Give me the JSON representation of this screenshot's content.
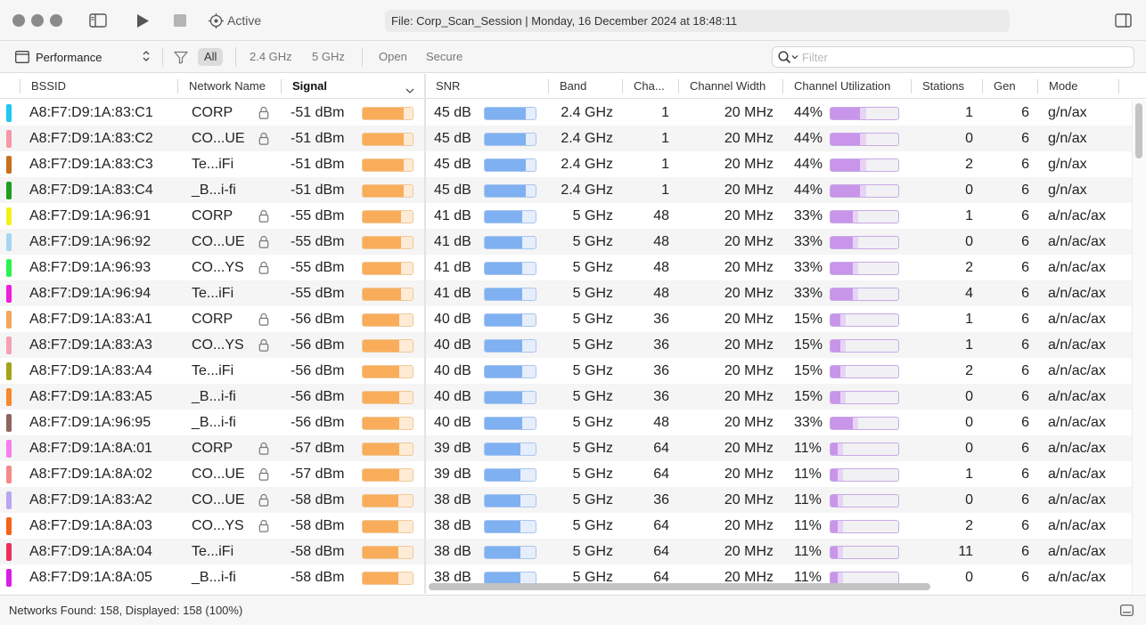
{
  "titlebar": {
    "state": "Active",
    "title": "File: Corp_Scan_Session | Monday, 16 December 2024 at 18:48:11"
  },
  "toolbar": {
    "view": "Performance",
    "filters": [
      "All",
      "2.4 GHz",
      "5 GHz",
      "Open",
      "Secure"
    ],
    "selected_filter": "All",
    "search_placeholder": "Filter"
  },
  "columns": {
    "bssid": "BSSID",
    "network_name": "Network Name",
    "signal": "Signal",
    "snr": "SNR",
    "band": "Band",
    "channel": "Cha...",
    "channel_width": "Channel Width",
    "channel_utilization": "Channel Utilization",
    "stations": "Stations",
    "gen": "Gen",
    "mode": "Mode"
  },
  "colors": {
    "signal_fill": "#f9ad5b",
    "snr_fill": "#7fb0f1",
    "util_fill": "#c895ea",
    "util_secondary": "#e6d3f6"
  },
  "rows": [
    {
      "color": "#1ec8ef",
      "bssid": "A8:F7:D9:1A:83:C1",
      "name": "CORP",
      "lock": true,
      "signal": "-51 dBm",
      "signal_level": 0.82,
      "snr": "45 dB",
      "snr_level": 0.8,
      "band": "2.4 GHz",
      "channel": "1",
      "width": "20 MHz",
      "util": "44%",
      "util_level": 0.44,
      "stations": "1",
      "gen": "6",
      "mode": "g/n/ax"
    },
    {
      "color": "#f598a8",
      "bssid": "A8:F7:D9:1A:83:C2",
      "name": "CO...UE",
      "lock": true,
      "signal": "-51 dBm",
      "signal_level": 0.82,
      "snr": "45 dB",
      "snr_level": 0.8,
      "band": "2.4 GHz",
      "channel": "1",
      "width": "20 MHz",
      "util": "44%",
      "util_level": 0.44,
      "stations": "0",
      "gen": "6",
      "mode": "g/n/ax"
    },
    {
      "color": "#c8711c",
      "bssid": "A8:F7:D9:1A:83:C3",
      "name": "Te...iFi",
      "lock": false,
      "signal": "-51 dBm",
      "signal_level": 0.82,
      "snr": "45 dB",
      "snr_level": 0.8,
      "band": "2.4 GHz",
      "channel": "1",
      "width": "20 MHz",
      "util": "44%",
      "util_level": 0.44,
      "stations": "2",
      "gen": "6",
      "mode": "g/n/ax"
    },
    {
      "color": "#1f9e1f",
      "bssid": "A8:F7:D9:1A:83:C4",
      "name": "_B...i-fi",
      "lock": false,
      "signal": "-51 dBm",
      "signal_level": 0.82,
      "snr": "45 dB",
      "snr_level": 0.8,
      "band": "2.4 GHz",
      "channel": "1",
      "width": "20 MHz",
      "util": "44%",
      "util_level": 0.44,
      "stations": "0",
      "gen": "6",
      "mode": "g/n/ax"
    },
    {
      "color": "#f4f01c",
      "bssid": "A8:F7:D9:1A:96:91",
      "name": "CORP",
      "lock": true,
      "signal": "-55 dBm",
      "signal_level": 0.76,
      "snr": "41 dB",
      "snr_level": 0.74,
      "band": "5 GHz",
      "channel": "48",
      "width": "20 MHz",
      "util": "33%",
      "util_level": 0.33,
      "stations": "1",
      "gen": "6",
      "mode": "a/n/ac/ax"
    },
    {
      "color": "#a8d6f0",
      "bssid": "A8:F7:D9:1A:96:92",
      "name": "CO...UE",
      "lock": true,
      "signal": "-55 dBm",
      "signal_level": 0.76,
      "snr": "41 dB",
      "snr_level": 0.74,
      "band": "5 GHz",
      "channel": "48",
      "width": "20 MHz",
      "util": "33%",
      "util_level": 0.33,
      "stations": "0",
      "gen": "6",
      "mode": "a/n/ac/ax"
    },
    {
      "color": "#2ef24e",
      "bssid": "A8:F7:D9:1A:96:93",
      "name": "CO...YS",
      "lock": true,
      "signal": "-55 dBm",
      "signal_level": 0.76,
      "snr": "41 dB",
      "snr_level": 0.74,
      "band": "5 GHz",
      "channel": "48",
      "width": "20 MHz",
      "util": "33%",
      "util_level": 0.33,
      "stations": "2",
      "gen": "6",
      "mode": "a/n/ac/ax"
    },
    {
      "color": "#ee1fd8",
      "bssid": "A8:F7:D9:1A:96:94",
      "name": "Te...iFi",
      "lock": false,
      "signal": "-55 dBm",
      "signal_level": 0.76,
      "snr": "41 dB",
      "snr_level": 0.74,
      "band": "5 GHz",
      "channel": "48",
      "width": "20 MHz",
      "util": "33%",
      "util_level": 0.33,
      "stations": "4",
      "gen": "6",
      "mode": "a/n/ac/ax"
    },
    {
      "color": "#f5a55c",
      "bssid": "A8:F7:D9:1A:83:A1",
      "name": "CORP",
      "lock": true,
      "signal": "-56 dBm",
      "signal_level": 0.74,
      "snr": "40 dB",
      "snr_level": 0.73,
      "band": "5 GHz",
      "channel": "36",
      "width": "20 MHz",
      "util": "15%",
      "util_level": 0.15,
      "stations": "1",
      "gen": "6",
      "mode": "a/n/ac/ax"
    },
    {
      "color": "#f6a1b1",
      "bssid": "A8:F7:D9:1A:83:A3",
      "name": "CO...YS",
      "lock": true,
      "signal": "-56 dBm",
      "signal_level": 0.74,
      "snr": "40 dB",
      "snr_level": 0.73,
      "band": "5 GHz",
      "channel": "36",
      "width": "20 MHz",
      "util": "15%",
      "util_level": 0.15,
      "stations": "1",
      "gen": "6",
      "mode": "a/n/ac/ax"
    },
    {
      "color": "#a3a31a",
      "bssid": "A8:F7:D9:1A:83:A4",
      "name": "Te...iFi",
      "lock": false,
      "signal": "-56 dBm",
      "signal_level": 0.74,
      "snr": "40 dB",
      "snr_level": 0.73,
      "band": "5 GHz",
      "channel": "36",
      "width": "20 MHz",
      "util": "15%",
      "util_level": 0.15,
      "stations": "2",
      "gen": "6",
      "mode": "a/n/ac/ax"
    },
    {
      "color": "#f58a2c",
      "bssid": "A8:F7:D9:1A:83:A5",
      "name": "_B...i-fi",
      "lock": false,
      "signal": "-56 dBm",
      "signal_level": 0.74,
      "snr": "40 dB",
      "snr_level": 0.73,
      "band": "5 GHz",
      "channel": "36",
      "width": "20 MHz",
      "util": "15%",
      "util_level": 0.15,
      "stations": "0",
      "gen": "6",
      "mode": "a/n/ac/ax"
    },
    {
      "color": "#8e6560",
      "bssid": "A8:F7:D9:1A:96:95",
      "name": "_B...i-fi",
      "lock": false,
      "signal": "-56 dBm",
      "signal_level": 0.74,
      "snr": "40 dB",
      "snr_level": 0.73,
      "band": "5 GHz",
      "channel": "48",
      "width": "20 MHz",
      "util": "33%",
      "util_level": 0.33,
      "stations": "0",
      "gen": "6",
      "mode": "a/n/ac/ax"
    },
    {
      "color": "#f57ff0",
      "bssid": "A8:F7:D9:1A:8A:01",
      "name": "CORP",
      "lock": true,
      "signal": "-57 dBm",
      "signal_level": 0.73,
      "snr": "39 dB",
      "snr_level": 0.71,
      "band": "5 GHz",
      "channel": "64",
      "width": "20 MHz",
      "util": "11%",
      "util_level": 0.11,
      "stations": "0",
      "gen": "6",
      "mode": "a/n/ac/ax"
    },
    {
      "color": "#f58a8a",
      "bssid": "A8:F7:D9:1A:8A:02",
      "name": "CO...UE",
      "lock": true,
      "signal": "-57 dBm",
      "signal_level": 0.73,
      "snr": "39 dB",
      "snr_level": 0.71,
      "band": "5 GHz",
      "channel": "64",
      "width": "20 MHz",
      "util": "11%",
      "util_level": 0.11,
      "stations": "1",
      "gen": "6",
      "mode": "a/n/ac/ax"
    },
    {
      "color": "#b9a6f2",
      "bssid": "A8:F7:D9:1A:83:A2",
      "name": "CO...UE",
      "lock": true,
      "signal": "-58 dBm",
      "signal_level": 0.71,
      "snr": "38 dB",
      "snr_level": 0.7,
      "band": "5 GHz",
      "channel": "36",
      "width": "20 MHz",
      "util": "11%",
      "util_level": 0.11,
      "stations": "0",
      "gen": "6",
      "mode": "a/n/ac/ax"
    },
    {
      "color": "#f5621a",
      "bssid": "A8:F7:D9:1A:8A:03",
      "name": "CO...YS",
      "lock": true,
      "signal": "-58 dBm",
      "signal_level": 0.71,
      "snr": "38 dB",
      "snr_level": 0.7,
      "band": "5 GHz",
      "channel": "64",
      "width": "20 MHz",
      "util": "11%",
      "util_level": 0.11,
      "stations": "2",
      "gen": "6",
      "mode": "a/n/ac/ax"
    },
    {
      "color": "#ee2f5a",
      "bssid": "A8:F7:D9:1A:8A:04",
      "name": "Te...iFi",
      "lock": false,
      "signal": "-58 dBm",
      "signal_level": 0.71,
      "snr": "38 dB",
      "snr_level": 0.7,
      "band": "5 GHz",
      "channel": "64",
      "width": "20 MHz",
      "util": "11%",
      "util_level": 0.11,
      "stations": "11",
      "gen": "6",
      "mode": "a/n/ac/ax"
    },
    {
      "color": "#d91fe6",
      "bssid": "A8:F7:D9:1A:8A:05",
      "name": "_B...i-fi",
      "lock": false,
      "signal": "-58 dBm",
      "signal_level": 0.71,
      "snr": "38 dB",
      "snr_level": 0.7,
      "band": "5 GHz",
      "channel": "64",
      "width": "20 MHz",
      "util": "11%",
      "util_level": 0.11,
      "stations": "0",
      "gen": "6",
      "mode": "a/n/ac/ax"
    }
  ],
  "status": {
    "text": "Networks Found: 158, Displayed: 158 (100%)"
  }
}
